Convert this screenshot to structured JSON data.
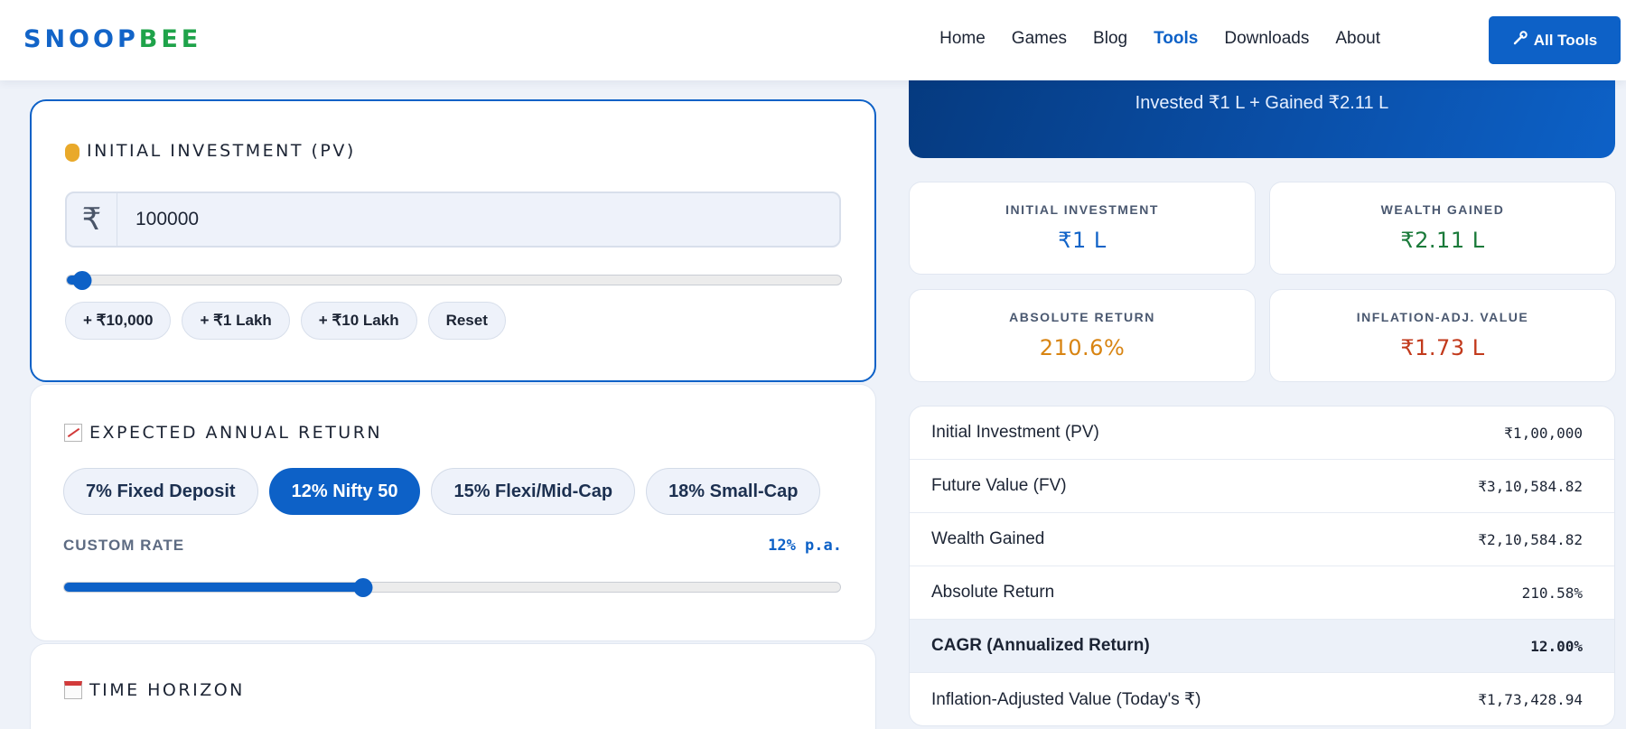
{
  "header": {
    "logo_part1": "SNOOP",
    "logo_part2": "BEE",
    "nav": [
      "Home",
      "Games",
      "Blog",
      "Tools",
      "Downloads",
      "About"
    ],
    "active_nav": "Tools",
    "all_tools_label": "All Tools",
    "all_tools_icon": "wrench-icon",
    "colors": {
      "brand_blue": "#0d61c7",
      "brand_green": "#1fa34a"
    }
  },
  "initial_investment": {
    "title": "INITIAL INVESTMENT (PV)",
    "icon": "money-bag-icon",
    "currency_symbol": "₹",
    "value": "100000",
    "slider_fraction": 0.02,
    "quick_add": [
      "+ ₹10,000",
      "+ ₹1 Lakh",
      "+ ₹10 Lakh",
      "Reset"
    ]
  },
  "annual_return": {
    "title": "EXPECTED ANNUAL RETURN",
    "icon": "chart-increasing-icon",
    "presets": [
      "7% Fixed Deposit",
      "12% Nifty 50",
      "15% Flexi/Mid-Cap",
      "18% Small-Cap"
    ],
    "selected_preset": "12% Nifty 50",
    "custom_rate_label": "CUSTOM RATE",
    "custom_rate_value": "12% p.a.",
    "slider_fraction": 0.385
  },
  "time_horizon": {
    "title": "TIME HORIZON",
    "icon": "calendar-icon"
  },
  "summary": {
    "hero_text": "Invested ₹1 L + Gained ₹2.11 L",
    "stats": [
      {
        "label": "INITIAL INVESTMENT",
        "value": "₹1 L",
        "color": "#1264c8"
      },
      {
        "label": "WEALTH GAINED",
        "value": "₹2.11 L",
        "color": "#1a7a3a"
      },
      {
        "label": "ABSOLUTE RETURN",
        "value": "210.6%",
        "color": "#d88412"
      },
      {
        "label": "INFLATION-ADJ. VALUE",
        "value": "₹1.73 L",
        "color": "#c23a1c"
      }
    ]
  },
  "breakdown": [
    {
      "label": "Initial Investment (PV)",
      "value": "₹1,00,000"
    },
    {
      "label": "Future Value (FV)",
      "value": "₹3,10,584.82"
    },
    {
      "label": "Wealth Gained",
      "value": "₹2,10,584.82"
    },
    {
      "label": "Absolute Return",
      "value": "210.58%"
    },
    {
      "label": "CAGR (Annualized Return)",
      "value": "12.00%",
      "highlight": true
    },
    {
      "label": "Inflation-Adjusted Value (Today's ₹)",
      "value": "₹1,73,428.94"
    }
  ]
}
